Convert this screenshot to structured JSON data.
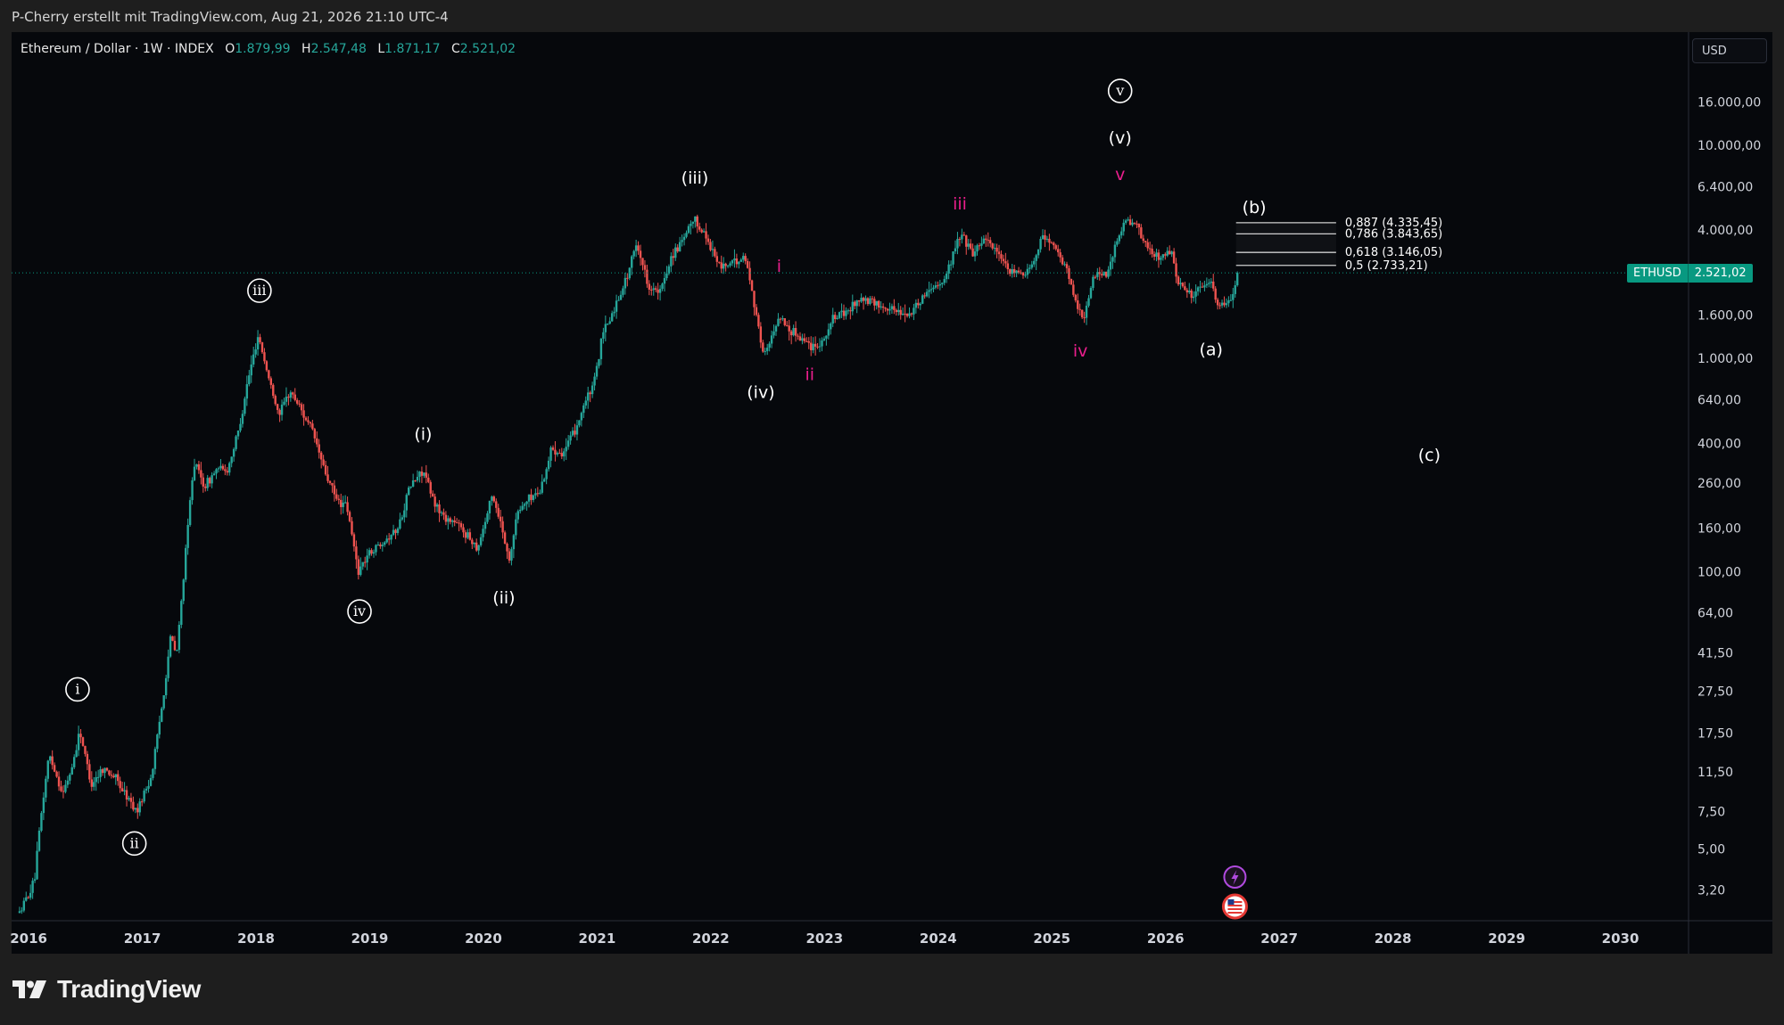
{
  "header": {
    "credit": "P-Cherry erstellt mit TradingView.com, Aug 21, 2026 21:10 UTC-4"
  },
  "legend": {
    "symbol": "Ethereum / Dollar · 1W · INDEX",
    "open_label": "O",
    "open": "1.879,99",
    "high_label": "H",
    "high": "2.547,48",
    "low_label": "L",
    "low": "1.871,17",
    "close_label": "C",
    "close": "2.521,02"
  },
  "currency_button": "USD",
  "price_tag": {
    "ticker": "ETHUSD",
    "price": "2.521,02"
  },
  "brand": {
    "name": "TradingView"
  },
  "colors": {
    "up": "#26a69a",
    "down": "#ef5350",
    "magenta": "#e91e8c",
    "background": "#06080c",
    "frame": "#1e1e1e",
    "price_line": "#089981"
  },
  "icons": [
    "tradingview-logo-icon",
    "lightning-event-icon",
    "us-flag-event-icon"
  ],
  "chart_data": {
    "type": "candlestick",
    "title": "Ethereum / Dollar · 1W · INDEX",
    "y_scale": "log",
    "y_ticks": [
      {
        "value": 16000,
        "label": "16.000,00"
      },
      {
        "value": 10000,
        "label": "10.000,00"
      },
      {
        "value": 6400,
        "label": "6.400,00"
      },
      {
        "value": 4000,
        "label": "4.000,00"
      },
      {
        "value": 1600,
        "label": "1.600,00"
      },
      {
        "value": 1000,
        "label": "1.000,00"
      },
      {
        "value": 640,
        "label": "640,00"
      },
      {
        "value": 400,
        "label": "400,00"
      },
      {
        "value": 260,
        "label": "260,00"
      },
      {
        "value": 160,
        "label": "160,00"
      },
      {
        "value": 100,
        "label": "100,00"
      },
      {
        "value": 64,
        "label": "64,00"
      },
      {
        "value": 41.5,
        "label": "41,50"
      },
      {
        "value": 27.5,
        "label": "27,50"
      },
      {
        "value": 17.5,
        "label": "17,50"
      },
      {
        "value": 11.5,
        "label": "11,50"
      },
      {
        "value": 7.5,
        "label": "7,50"
      },
      {
        "value": 5,
        "label": "5,00"
      },
      {
        "value": 3.2,
        "label": "3,20"
      }
    ],
    "x_ticks": [
      "2016",
      "2017",
      "2018",
      "2019",
      "2020",
      "2021",
      "2022",
      "2023",
      "2024",
      "2025",
      "2026",
      "2027",
      "2028",
      "2029",
      "2030"
    ],
    "x_range": [
      2015.85,
      2030.6
    ],
    "y_range": [
      2.3,
      34000
    ],
    "last_price": 2521.02,
    "price_path": [
      [
        2015.92,
        2.5
      ],
      [
        2016.05,
        3.5
      ],
      [
        2016.12,
        8
      ],
      [
        2016.18,
        14
      ],
      [
        2016.3,
        9
      ],
      [
        2016.38,
        12
      ],
      [
        2016.45,
        18
      ],
      [
        2016.55,
        10
      ],
      [
        2016.65,
        12
      ],
      [
        2016.75,
        11
      ],
      [
        2016.85,
        9
      ],
      [
        2016.95,
        7.5
      ],
      [
        2017.08,
        11
      ],
      [
        2017.18,
        25
      ],
      [
        2017.25,
        50
      ],
      [
        2017.3,
        40
      ],
      [
        2017.38,
        120
      ],
      [
        2017.45,
        330
      ],
      [
        2017.55,
        250
      ],
      [
        2017.65,
        300
      ],
      [
        2017.75,
        300
      ],
      [
        2017.85,
        470
      ],
      [
        2017.92,
        750
      ],
      [
        2018.02,
        1300
      ],
      [
        2018.1,
        850
      ],
      [
        2018.2,
        550
      ],
      [
        2018.3,
        700
      ],
      [
        2018.38,
        600
      ],
      [
        2018.5,
        450
      ],
      [
        2018.6,
        300
      ],
      [
        2018.7,
        220
      ],
      [
        2018.8,
        200
      ],
      [
        2018.9,
        100
      ],
      [
        2018.98,
        120
      ],
      [
        2019.12,
        140
      ],
      [
        2019.25,
        160
      ],
      [
        2019.35,
        250
      ],
      [
        2019.47,
        300
      ],
      [
        2019.55,
        220
      ],
      [
        2019.65,
        180
      ],
      [
        2019.75,
        170
      ],
      [
        2019.85,
        150
      ],
      [
        2019.95,
        130
      ],
      [
        2020.08,
        230
      ],
      [
        2020.18,
        150
      ],
      [
        2020.22,
        110
      ],
      [
        2020.3,
        190
      ],
      [
        2020.4,
        220
      ],
      [
        2020.5,
        240
      ],
      [
        2020.6,
        380
      ],
      [
        2020.7,
        360
      ],
      [
        2020.8,
        450
      ],
      [
        2020.88,
        600
      ],
      [
        2020.97,
        750
      ],
      [
        2021.05,
        1300
      ],
      [
        2021.15,
        1700
      ],
      [
        2021.27,
        2500
      ],
      [
        2021.35,
        3500
      ],
      [
        2021.45,
        2200
      ],
      [
        2021.55,
        2000
      ],
      [
        2021.65,
        3000
      ],
      [
        2021.75,
        3500
      ],
      [
        2021.85,
        4500
      ],
      [
        2021.95,
        3800
      ],
      [
        2022.08,
        2700
      ],
      [
        2022.2,
        2800
      ],
      [
        2022.3,
        3000
      ],
      [
        2022.37,
        2000
      ],
      [
        2022.45,
        1100
      ],
      [
        2022.5,
        1100
      ],
      [
        2022.6,
        1600
      ],
      [
        2022.7,
        1350
      ],
      [
        2022.8,
        1250
      ],
      [
        2022.88,
        1150
      ],
      [
        2022.98,
        1200
      ],
      [
        2023.08,
        1550
      ],
      [
        2023.2,
        1650
      ],
      [
        2023.3,
        1900
      ],
      [
        2023.45,
        1800
      ],
      [
        2023.6,
        1700
      ],
      [
        2023.75,
        1600
      ],
      [
        2023.85,
        1900
      ],
      [
        2023.95,
        2200
      ],
      [
        2024.05,
        2300
      ],
      [
        2024.15,
        3300
      ],
      [
        2024.2,
        3900
      ],
      [
        2024.3,
        3100
      ],
      [
        2024.4,
        3700
      ],
      [
        2024.5,
        3300
      ],
      [
        2024.6,
        2600
      ],
      [
        2024.7,
        2500
      ],
      [
        2024.8,
        2600
      ],
      [
        2024.92,
        3800
      ],
      [
        2025.02,
        3300
      ],
      [
        2025.12,
        2700
      ],
      [
        2025.2,
        1900
      ],
      [
        2025.28,
        1550
      ],
      [
        2025.38,
        2500
      ],
      [
        2025.48,
        2500
      ],
      [
        2025.58,
        3600
      ],
      [
        2025.65,
        4500
      ],
      [
        2025.75,
        4100
      ],
      [
        2025.85,
        3200
      ],
      [
        2025.95,
        3000
      ],
      [
        2026.05,
        3200
      ],
      [
        2026.12,
        2200
      ],
      [
        2026.22,
        2000
      ],
      [
        2026.32,
        2100
      ],
      [
        2026.4,
        2300
      ],
      [
        2026.47,
        1700
      ],
      [
        2026.55,
        1900
      ],
      [
        2026.6,
        2000
      ],
      [
        2026.64,
        2521
      ]
    ],
    "fib_levels": [
      {
        "ratio": 0.887,
        "price": 4335.45,
        "label": "0,887 (4.335,45)"
      },
      {
        "ratio": 0.786,
        "price": 3843.65,
        "label": "0,786 (3.843,65)"
      },
      {
        "ratio": 0.618,
        "price": 3146.05,
        "label": "0,618 (3.146,05)"
      },
      {
        "ratio": 0.5,
        "price": 2733.21,
        "label": "0,5 (2.733,21)"
      }
    ],
    "fib_x_range": [
      2026.62,
      2027.5
    ],
    "wave_labels": [
      {
        "text": "i",
        "x": 2016.43,
        "y": 28,
        "circled": true,
        "color": "#ffffff"
      },
      {
        "text": "ii",
        "x": 2016.93,
        "y": 5.3,
        "circled": true,
        "color": "#ffffff"
      },
      {
        "text": "iii",
        "x": 2018.03,
        "y": 2080,
        "circled": true,
        "color": "#ffffff"
      },
      {
        "text": "iv",
        "x": 2018.91,
        "y": 65,
        "circled": true,
        "color": "#ffffff"
      },
      {
        "text": "(i)",
        "x": 2019.47,
        "y": 440,
        "circled": false,
        "color": "#ffffff"
      },
      {
        "text": "(ii)",
        "x": 2020.18,
        "y": 75,
        "circled": false,
        "color": "#ffffff"
      },
      {
        "text": "(iii)",
        "x": 2021.86,
        "y": 7000,
        "circled": false,
        "color": "#ffffff"
      },
      {
        "text": "(iv)",
        "x": 2022.44,
        "y": 690,
        "circled": false,
        "color": "#ffffff"
      },
      {
        "text": "i",
        "x": 2022.6,
        "y": 2700,
        "circled": false,
        "color": "#e91e8c"
      },
      {
        "text": "ii",
        "x": 2022.87,
        "y": 840,
        "circled": false,
        "color": "#e91e8c"
      },
      {
        "text": "iii",
        "x": 2024.19,
        "y": 5300,
        "circled": false,
        "color": "#e91e8c"
      },
      {
        "text": "iv",
        "x": 2025.25,
        "y": 1080,
        "circled": false,
        "color": "#e91e8c"
      },
      {
        "text": "v",
        "x": 2025.6,
        "y": 7300,
        "circled": false,
        "color": "#e91e8c"
      },
      {
        "text": "(v)",
        "x": 2025.6,
        "y": 10800,
        "circled": false,
        "color": "#ffffff"
      },
      {
        "text": "v",
        "x": 2025.6,
        "y": 18000,
        "circled": true,
        "color": "#ffffff"
      },
      {
        "text": "(a)",
        "x": 2026.4,
        "y": 1100,
        "circled": false,
        "color": "#ffffff"
      },
      {
        "text": "(b)",
        "x": 2026.78,
        "y": 5100,
        "circled": false,
        "color": "#ffffff"
      },
      {
        "text": "(c)",
        "x": 2028.32,
        "y": 350,
        "circled": false,
        "color": "#ffffff"
      }
    ]
  }
}
